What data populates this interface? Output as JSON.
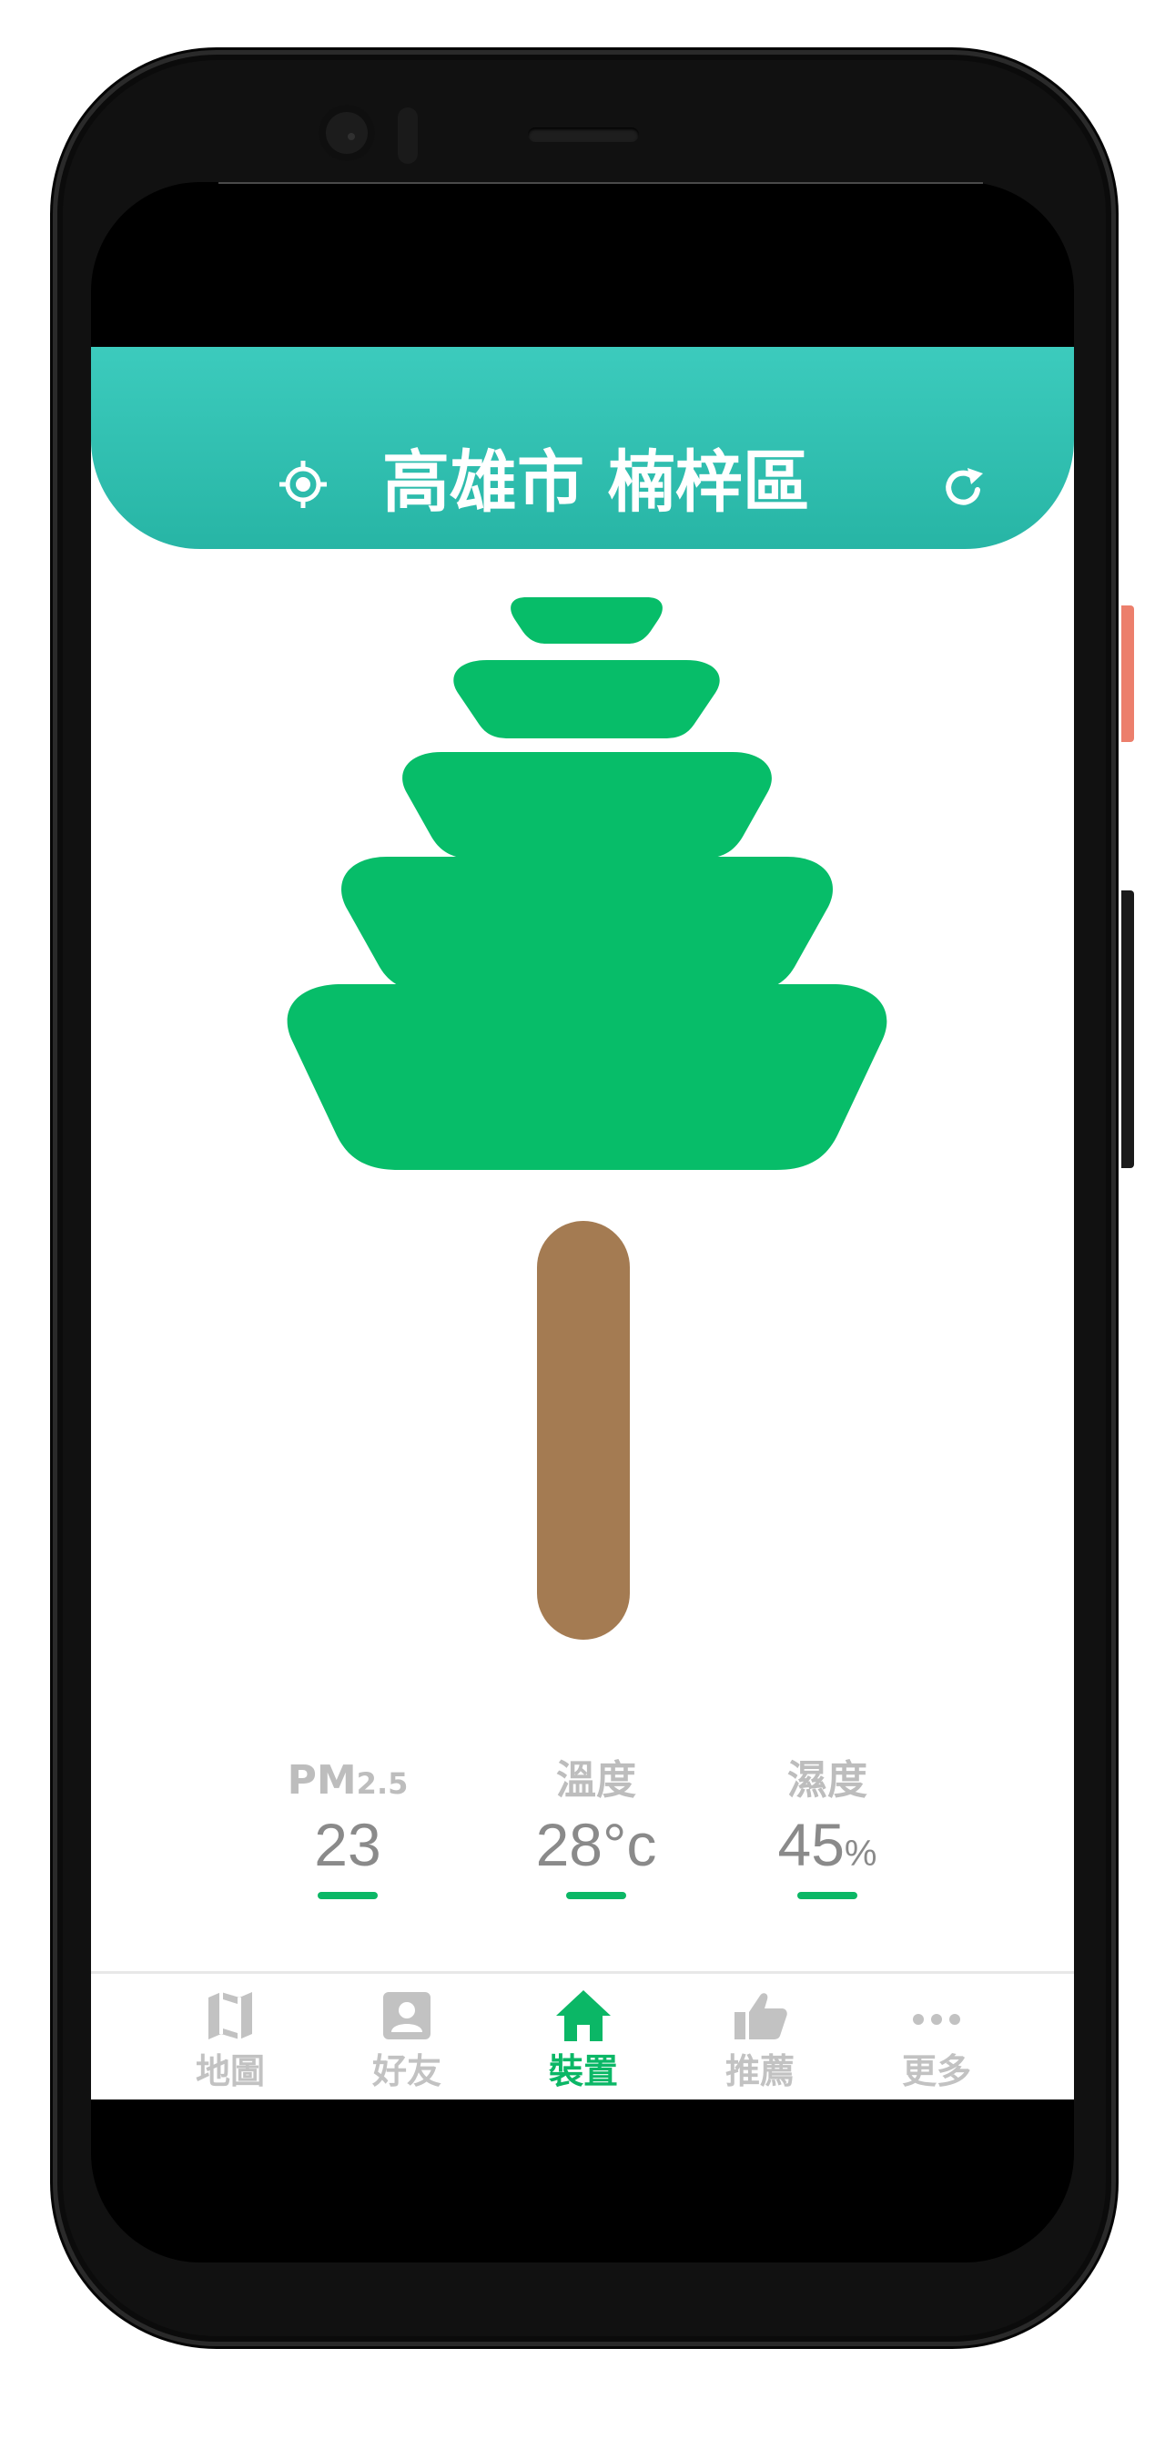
{
  "header": {
    "location": "高雄市 楠梓區",
    "locate_icon": "crosshair-icon",
    "refresh_icon": "refresh-icon"
  },
  "colors": {
    "header_gradient_top": "#3ccbbd",
    "header_gradient_bottom": "#27b5a5",
    "foliage": "#07bd69",
    "trunk": "#a47b52",
    "accent": "#0bb766",
    "stat_label": "#bdbdbd",
    "stat_value": "#8a8a8a",
    "nav_inactive": "#c2c2c2"
  },
  "stats": {
    "pm": {
      "label_main": "PM",
      "label_sub": "2.5",
      "value": "23"
    },
    "temperature": {
      "label": "溫度",
      "value": "28",
      "unit": "°c"
    },
    "humidity": {
      "label": "濕度",
      "value": "45",
      "unit": "%"
    }
  },
  "nav": {
    "items": [
      {
        "label": "地圖",
        "icon": "map-icon",
        "active": false
      },
      {
        "label": "好友",
        "icon": "contact-icon",
        "active": false
      },
      {
        "label": "裝置",
        "icon": "home-icon",
        "active": true
      },
      {
        "label": "推薦",
        "icon": "thumbs-up-icon",
        "active": false
      },
      {
        "label": "更多",
        "icon": "more-dots-icon",
        "active": false
      }
    ]
  }
}
